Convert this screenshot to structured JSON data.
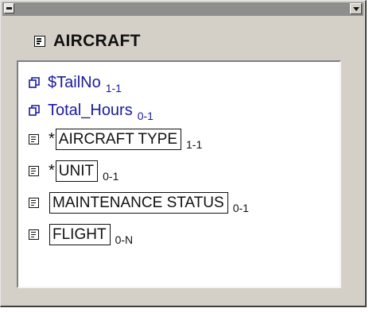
{
  "entity": {
    "title": "AIRCRAFT",
    "icon": "entity-icon"
  },
  "attributes": [
    {
      "name": "$TailNo",
      "cardinality": "1-1",
      "icon": "link-icon"
    },
    {
      "name": "Total_Hours",
      "cardinality": "0-1",
      "icon": "link-icon"
    }
  ],
  "relationships": [
    {
      "prefix": "*",
      "name": "AIRCRAFT TYPE",
      "cardinality": "1-1",
      "icon": "entity-icon"
    },
    {
      "prefix": "*",
      "name": "UNIT",
      "cardinality": "0-1",
      "icon": "entity-icon"
    },
    {
      "prefix": "",
      "name": "MAINTENANCE STATUS",
      "cardinality": "0-1",
      "icon": "entity-icon"
    },
    {
      "prefix": "",
      "name": "FLIGHT",
      "cardinality": "0-N",
      "icon": "entity-icon"
    }
  ],
  "colors": {
    "attribute_text": "#1a1aa0",
    "window_face": "#d4d0c8",
    "titlebar": "#8e8e8e"
  }
}
